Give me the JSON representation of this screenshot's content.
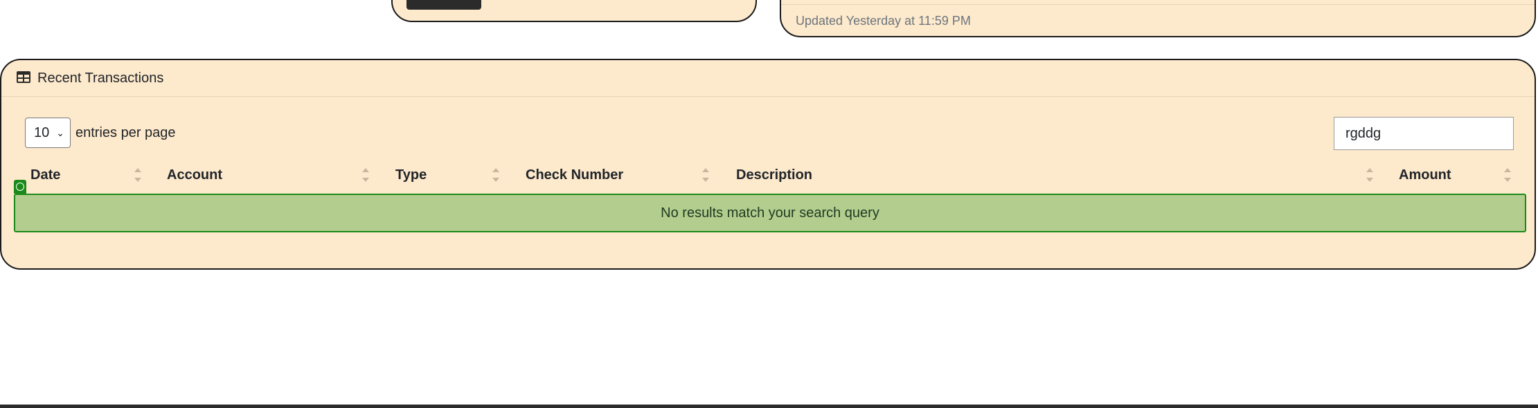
{
  "top_card_right": {
    "updated_text": "Updated Yesterday at 11:59 PM"
  },
  "transactions": {
    "title": "Recent Transactions",
    "per_page_value": "10",
    "per_page_label": "entries per page",
    "search_value": "rgddg",
    "columns": [
      "Date",
      "Account",
      "Type",
      "Check Number",
      "Description",
      "Amount"
    ],
    "empty_message": "No results match your search query"
  },
  "icons": {
    "header_icon": "table-icon",
    "select_icon": "chevron-down-icon",
    "sort_icon": "sort-icon",
    "row_marker_icon": "target-icon"
  },
  "colors": {
    "card_background": "#fde9cc",
    "empty_row_background": "#b3cd8f",
    "empty_row_border": "#1a8a1a"
  }
}
